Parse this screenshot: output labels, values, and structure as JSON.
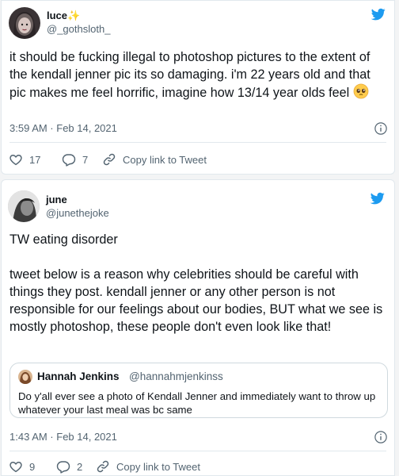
{
  "tweets": [
    {
      "name": "luce",
      "name_emoji": "✨",
      "handle": "@_gothsloth_",
      "text": "it should be fucking illegal to photoshop pictures to the extent of the kendall jenner pic its so damaging. i'm 22 years old and that pic makes me feel horrific, imagine how 13/14 year olds feel",
      "timestamp": "3:59 AM · Feb 14, 2021",
      "likes": "17",
      "replies": "7",
      "copy_link": "Copy link to Tweet"
    },
    {
      "name": "june",
      "handle": "@junethejoke",
      "text": "TW eating disorder\n\ntweet below is a reason why celebrities should be careful with things they post. kendall jenner or any other person is not responsible for our feelings about our bodies, BUT what we see is mostly photoshop, these people don't even look like that!",
      "quote": {
        "name": "Hannah Jenkins",
        "handle": "@hannahmjenkinss",
        "text": "Do y'all ever see a photo of Kendall Jenner and immediately want to throw up whatever your last meal was bc same"
      },
      "timestamp": "1:43 AM · Feb 14, 2021",
      "likes": "9",
      "replies": "2",
      "copy_link": "Copy link to Tweet"
    }
  ],
  "colors": {
    "twitter_blue": "#1d9bf0",
    "muted": "#536471",
    "text": "#0f1419"
  },
  "icons": [
    "twitter-bird-icon",
    "info-icon",
    "heart-icon",
    "reply-icon",
    "link-icon",
    "pleading-face-emoji"
  ]
}
